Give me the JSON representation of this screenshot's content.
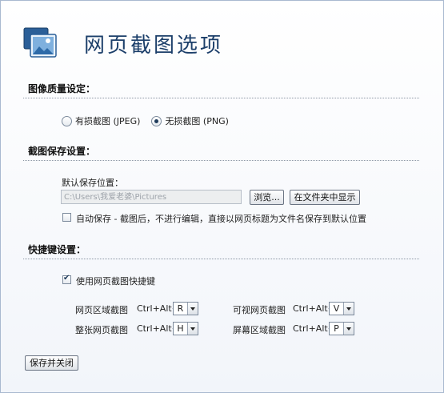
{
  "header": {
    "title": "网页截图选项"
  },
  "quality": {
    "section_title": "图像质量设定：",
    "options": [
      {
        "label": "有损截图 (JPEG)",
        "checked": false
      },
      {
        "label": "无损截图 (PNG)",
        "checked": true
      }
    ]
  },
  "save": {
    "section_title": "截图保存设置：",
    "default_location_label": "默认保存位置：",
    "path_value": "C:\\Users\\我爱老婆\\Pictures",
    "browse_label": "浏览...",
    "show_in_folder_label": "在文件夹中显示",
    "auto_save_label": "自动保存 - 截图后，不进行编辑，直接以网页标题为文件名保存到默认位置",
    "auto_save_checked": false
  },
  "shortcuts": {
    "section_title": "快捷键设置：",
    "enable_label": "使用网页截图快捷键",
    "enable_checked": true,
    "items": [
      {
        "label": "网页区域截图",
        "prefix": "Ctrl+Alt+",
        "key": "R"
      },
      {
        "label": "可视网页截图",
        "prefix": "Ctrl+Alt+",
        "key": "V"
      },
      {
        "label": "整张网页截图",
        "prefix": "Ctrl+Alt+",
        "key": "H"
      },
      {
        "label": "屏幕区域截图",
        "prefix": "Ctrl+Alt+",
        "key": "P"
      }
    ]
  },
  "footer": {
    "save_close_label": "保存并关闭"
  },
  "colors": {
    "title": "#1c3f6a",
    "accent": "#203c5c",
    "border": "#a9b9d0"
  }
}
